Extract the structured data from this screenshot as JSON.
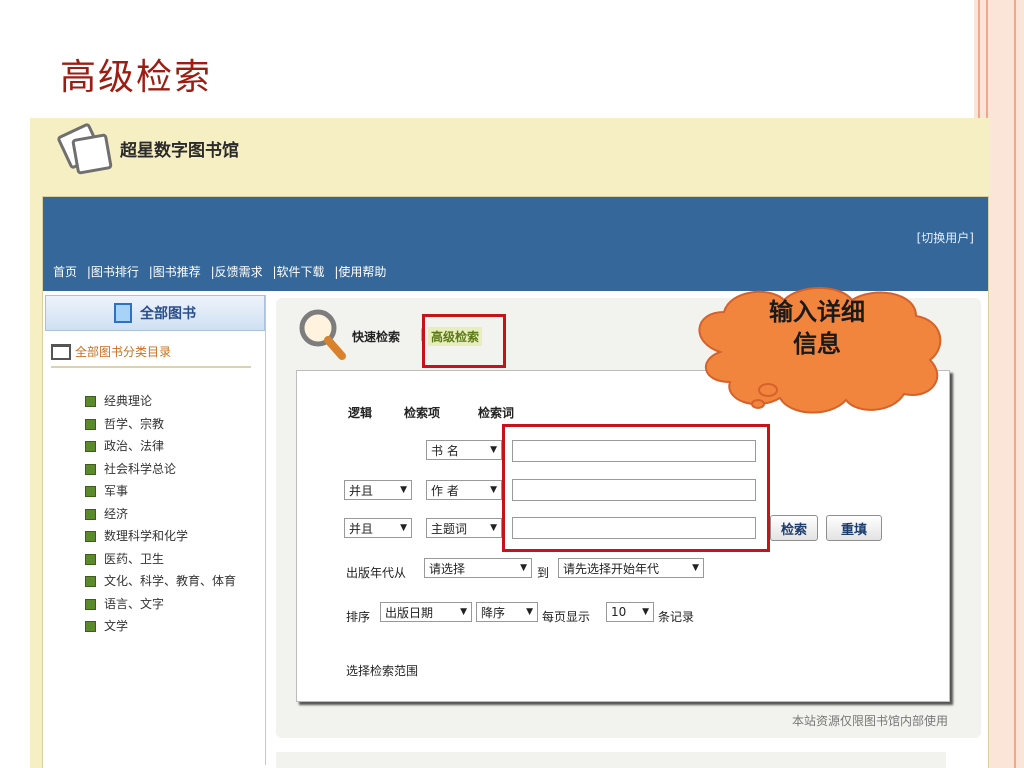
{
  "slide": {
    "title": "高级检索"
  },
  "app": {
    "title": "超星数字图书馆",
    "switch_user": "[切换用户]"
  },
  "nav": {
    "items": [
      "首页",
      "|图书排行",
      "|图书推荐",
      "|反馈需求",
      "|软件下载",
      "|使用帮助"
    ]
  },
  "sidebar": {
    "header": "全部图书",
    "category_link": "全部图书分类目录",
    "items": [
      "经典理论",
      "哲学、宗教",
      "政治、法律",
      "社会科学总论",
      "军事",
      "经济",
      "数理科学和化学",
      "医药、卫生",
      "文化、科学、教育、体育",
      "语言、文字",
      "文学"
    ]
  },
  "search": {
    "tab_quick": "快速检索",
    "tab_separator": "|",
    "tab_advanced": "高级检索",
    "headers": {
      "logic": "逻辑",
      "field": "检索项",
      "term": "检索词"
    },
    "rows": [
      {
        "logic": "",
        "field": "书 名",
        "term": ""
      },
      {
        "logic": "并且",
        "field": "作 者",
        "term": ""
      },
      {
        "logic": "并且",
        "field": "主题词",
        "term": ""
      }
    ],
    "search_button": "检索",
    "reset_button": "重填",
    "year_label": "出版年代从",
    "year_from": "请选择",
    "year_to_label": "到",
    "year_to": "请先选择开始年代",
    "sort_label": "排序",
    "sort_field": "出版日期",
    "sort_order": "降序",
    "page_size_label": "每页显示",
    "page_size": "10",
    "page_size_suffix": "条记录",
    "scope_label": "选择检索范围"
  },
  "footer_note": "本站资源仅限图书馆内部使用",
  "callout": {
    "line1": "输入详细",
    "line2": "信息"
  },
  "colors": {
    "title_red": "#9c1d12",
    "nav_blue": "#35679a",
    "highlight_red": "#c4141a",
    "callout_orange": "#f2853e",
    "header_band": "#f6efc4"
  }
}
